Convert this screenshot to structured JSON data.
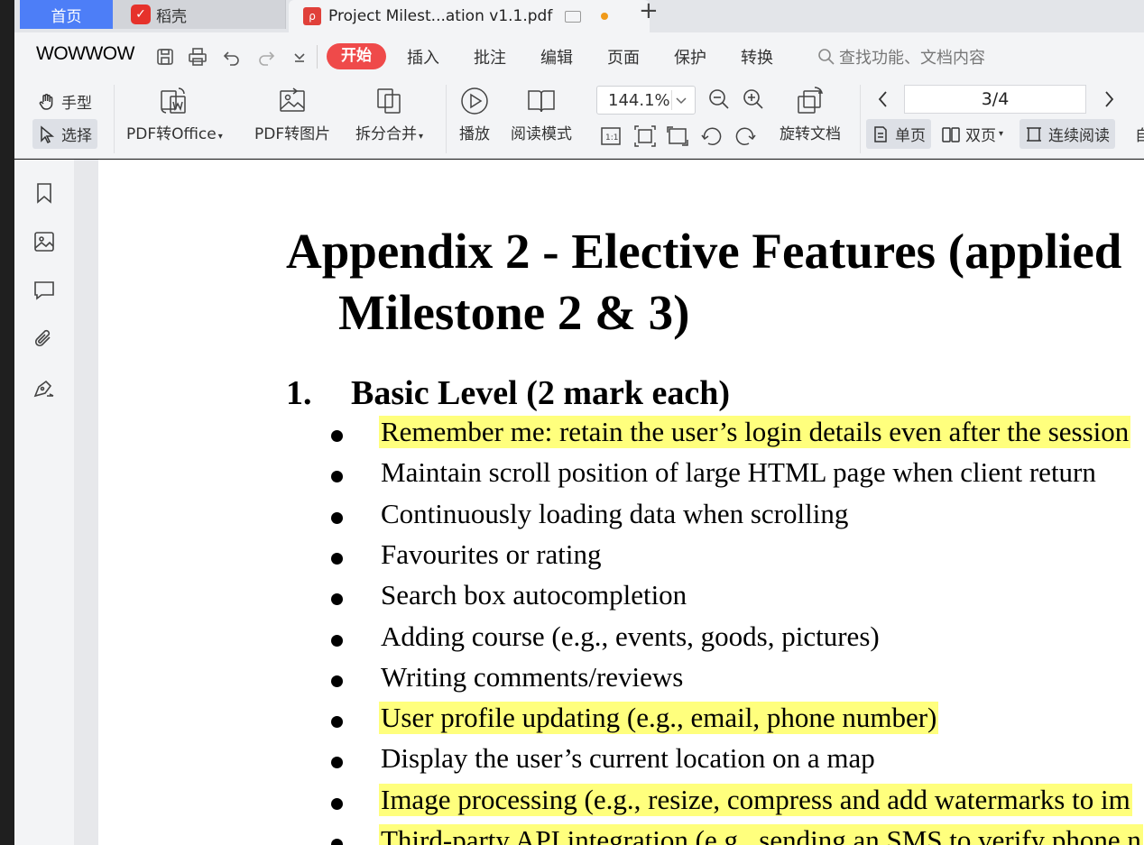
{
  "tabs": {
    "home": "首页",
    "docer": "稻壳",
    "document": "Project Milest...ation v1.1.pdf",
    "add": "+"
  },
  "menubar": {
    "overlay_text": "WOWWOW",
    "items": [
      "开始",
      "插入",
      "批注",
      "编辑",
      "页面",
      "保护",
      "转换"
    ],
    "search_placeholder": "查找功能、文档内容"
  },
  "ribbon": {
    "hand_tool": "手型",
    "select_tool": "选择",
    "pdf_to_office": "PDF转Office",
    "pdf_to_image": "PDF转图片",
    "split_merge": "拆分合并",
    "play": "播放",
    "read_mode": "阅读模式",
    "zoom_value": "144.1%",
    "rotate_doc": "旋转文档",
    "page_indicator": "3/4",
    "single_page": "单页",
    "double_page": "双页",
    "continuous_read": "连续阅读",
    "auto_partial": "自"
  },
  "document": {
    "title_line1": "Appendix 2 - Elective Features (applied",
    "title_line2": "Milestone 2 & 3)",
    "section_number": "1.",
    "section_title": "Basic Level (2 mark each)",
    "bullets": [
      {
        "text": "Remember me: retain the user’s login details even after the session",
        "highlighted": true
      },
      {
        "text": "Maintain scroll position of large HTML page when client return",
        "highlighted": false
      },
      {
        "text": "Continuously loading data when scrolling",
        "highlighted": false
      },
      {
        "text": "Favourites or rating",
        "highlighted": false
      },
      {
        "text": "Search box autocompletion",
        "highlighted": false
      },
      {
        "text": "Adding course (e.g., events, goods, pictures)",
        "highlighted": false
      },
      {
        "text": "Writing comments/reviews",
        "highlighted": false
      },
      {
        "text": "User profile updating (e.g., email, phone number)",
        "highlighted": true
      },
      {
        "text": "Display the user’s current location on a map",
        "highlighted": false
      },
      {
        "text": "Image processing (e.g., resize, compress and add watermarks to im",
        "highlighted": true
      },
      {
        "text": "Third-party API integration (e.g., sending an SMS to verify phone n",
        "highlighted": true
      }
    ]
  },
  "colors": {
    "highlight": "#ffff7d",
    "accent": "#4d7ef7",
    "start_button": "#ef4a4a"
  }
}
